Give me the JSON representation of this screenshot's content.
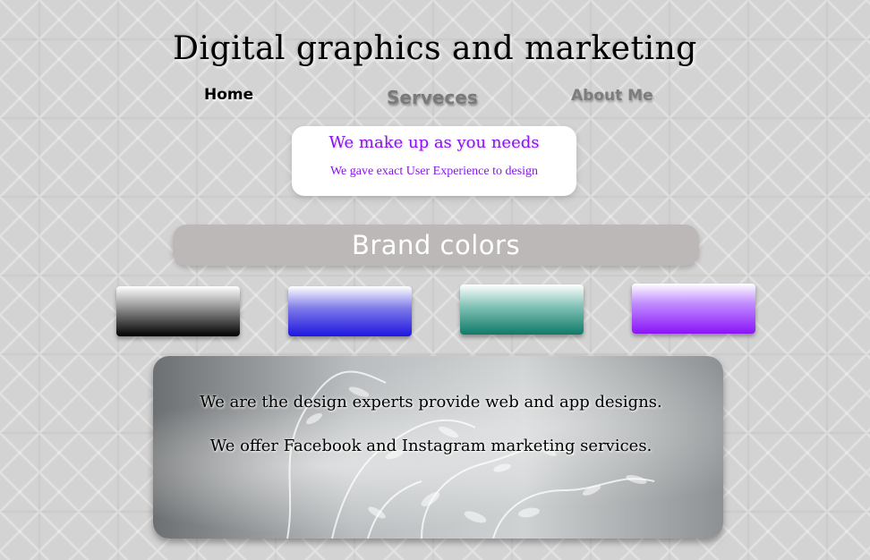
{
  "header": {
    "title": "Digital graphics and marketing"
  },
  "nav": {
    "home": "Home",
    "services": "Serveces",
    "about": "About Me"
  },
  "promo": {
    "title": "We make up as you needs",
    "subtitle": "We gave exact User Experience to design"
  },
  "brand": {
    "label": "Brand colors",
    "swatches": [
      {
        "name": "black-gradient",
        "color": "#000000"
      },
      {
        "name": "blue-gradient",
        "color": "#1f15e0"
      },
      {
        "name": "teal-gradient",
        "color": "#0f7a68"
      },
      {
        "name": "purple-gradient",
        "color": "#8a14f8"
      }
    ]
  },
  "hero": {
    "line1": "We are the  design experts provide web and app designs.",
    "line2": "We offer Facebook and Instagram marketing services."
  },
  "colors": {
    "accent": "#8a14f0",
    "brand_bar": "#bdb8b8"
  }
}
